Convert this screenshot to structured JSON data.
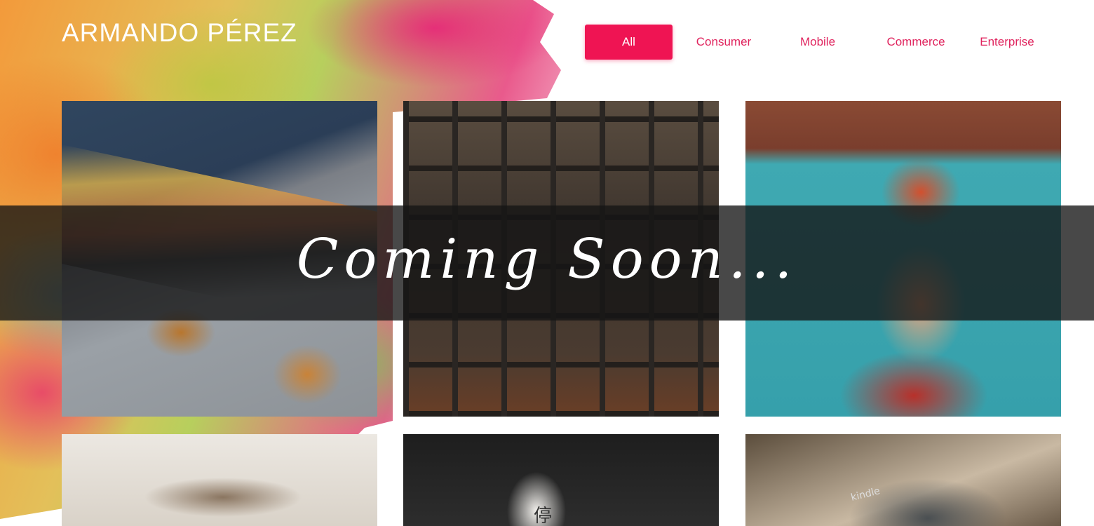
{
  "header": {
    "brand": "ARMANDO PÉREZ"
  },
  "nav": {
    "items": [
      {
        "label": "All",
        "active": true
      },
      {
        "label": "Consumer",
        "active": false
      },
      {
        "label": "Mobile",
        "active": false
      },
      {
        "label": "Commerce",
        "active": false
      },
      {
        "label": "Enterprise",
        "active": false
      }
    ]
  },
  "overlay": {
    "text": "Coming Soon..."
  },
  "gallery": {
    "tiles": [
      {
        "subject": "skateboard shoes"
      },
      {
        "subject": "bookshelf"
      },
      {
        "subject": "street mural"
      },
      {
        "subject": "pebbles"
      },
      {
        "subject": "paper lantern",
        "text": "停"
      },
      {
        "subject": "kindle",
        "text": "kindle"
      }
    ]
  },
  "colors": {
    "accent": "#ef1453",
    "nav_text": "#e0245e",
    "overlay": "#141414"
  }
}
